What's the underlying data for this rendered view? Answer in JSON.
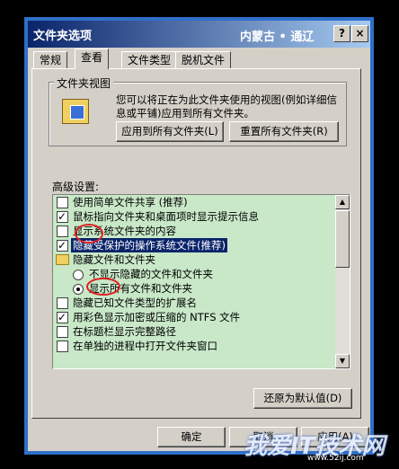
{
  "window": {
    "title": "文件夹选项",
    "help_btn": "?",
    "close_btn": "×"
  },
  "watermark": {
    "top": "内蒙古 • 通辽",
    "logo": "我爱IT技术网",
    "url": "www.52ij.com"
  },
  "tabs": [
    "常规",
    "查看",
    "文件类型",
    "脱机文件"
  ],
  "folder_views": {
    "label": "文件夹视图",
    "description": "您可以将正在为此文件夹使用的视图(例如详细信息或平铺)应用到所有文件夹。",
    "apply_all": "应用到所有文件夹(L)",
    "reset_all": "重置所有文件夹(R)"
  },
  "advanced": {
    "label": "高级设置:",
    "items": [
      {
        "type": "checkbox",
        "checked": false,
        "label": "使用简单文件共享 (推荐)"
      },
      {
        "type": "checkbox",
        "checked": true,
        "label": "鼠标指向文件夹和桌面项时显示提示信息"
      },
      {
        "type": "checkbox",
        "checked": false,
        "label": "显示系统文件夹的内容"
      },
      {
        "type": "checkbox",
        "checked": true,
        "label": "隐藏受保护的操作系统文件(推荐)",
        "selected": true
      },
      {
        "type": "folder",
        "label": "隐藏文件和文件夹"
      },
      {
        "type": "radio",
        "checked": false,
        "label": "不显示隐藏的文件和文件夹"
      },
      {
        "type": "radio",
        "checked": true,
        "label": "显示所有文件和文件夹"
      },
      {
        "type": "checkbox",
        "checked": false,
        "label": "隐藏已知文件类型的扩展名"
      },
      {
        "type": "checkbox",
        "checked": true,
        "label": "用彩色显示加密或压缩的 NTFS 文件"
      },
      {
        "type": "checkbox",
        "checked": false,
        "label": "在标题栏显示完整路径"
      },
      {
        "type": "checkbox",
        "checked": false,
        "label": "在单独的进程中打开文件夹窗口"
      }
    ],
    "restore_defaults": "还原为默认值(D)"
  },
  "footer": {
    "ok": "确定",
    "cancel": "取消",
    "apply": "应用(A)"
  }
}
